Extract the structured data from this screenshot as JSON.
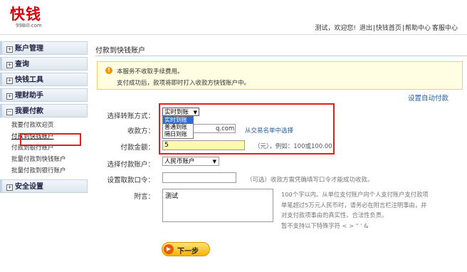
{
  "header": {
    "logo_text": "快钱",
    "logo_sub": "99Bill.com",
    "greeting": "测试，欢迎您!",
    "links": [
      "退出",
      "快钱首页",
      "帮助中心",
      "客服中心"
    ]
  },
  "sidebar": {
    "sections": [
      {
        "label": "账户管理"
      },
      {
        "label": "查询"
      },
      {
        "label": "快钱工具"
      },
      {
        "label": "理财助手"
      },
      {
        "label": "我要付款"
      },
      {
        "label": "安全设置"
      }
    ],
    "pay_items": [
      "我要付款欢迎页",
      "付款到快钱账户",
      "付款到银行账户",
      "批量付款到快钱账户",
      "批量付款到银行账户"
    ]
  },
  "main": {
    "title": "付款到快钱账户",
    "notice": {
      "icon": "info-icon",
      "line1": "本服务不收取手续费用。",
      "line2": "支付成功后，款项将即时打入收款方快钱账户中。"
    },
    "auto_pay_link": "设置自动付款",
    "form": {
      "method_label": "选择转账方式：",
      "method_value": "实时到账",
      "method_options": [
        "实时到账",
        "普通到账",
        "隔日到账"
      ],
      "payee_label": "收款方：",
      "payee_value": "q.com",
      "payee_link": "从交易名单中选择",
      "amount_label": "付款金额：",
      "amount_value": "5",
      "amount_hint": "（元），例如：100或100.00",
      "account_label": "选择付款账户：",
      "account_value": "人民币账户",
      "password_label": "设置取款口令：",
      "password_value": "",
      "password_hint": "（可选）收款方需凭确填写口令才能成功收款。",
      "note_label": "附言：",
      "note_value": "测试",
      "note_hint": [
        "100个字以内。从单位支付账户向个人支付账户支付款项",
        "单笔超过5万元人民币时，请务必在附言栏注明事由，并",
        "对支付款项事由的真实性、合法性负责。",
        "暂不支持以下特殊字符 < > \" ' &"
      ]
    },
    "next_button": "下一步"
  },
  "colors": {
    "brand_red": "#d7000f",
    "highlight_red": "#e02020",
    "link_blue": "#1f5c9e",
    "notice_bg": "#fffde2",
    "button_yellow": "#f7b200"
  }
}
